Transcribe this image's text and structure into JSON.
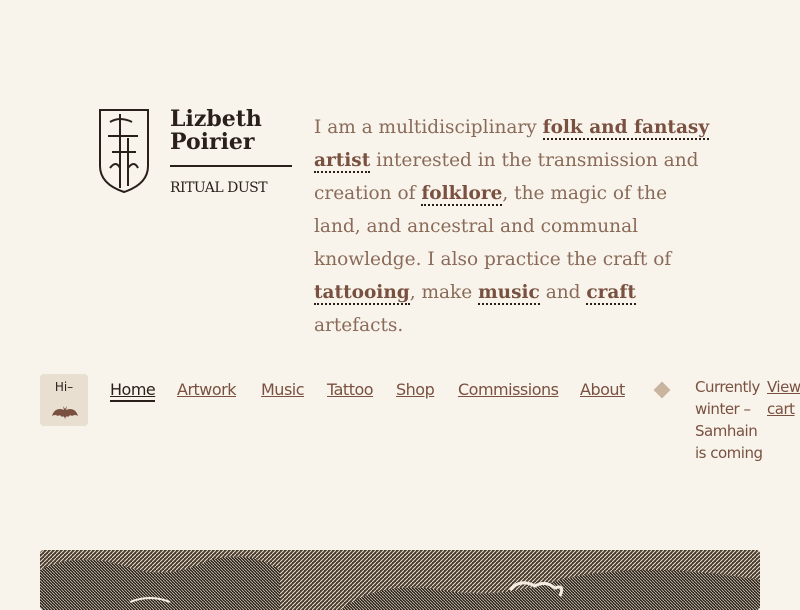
{
  "brand": {
    "name_line1": "Lizbeth",
    "name_line2": "Poirier",
    "tagline": "RITUAL DUST"
  },
  "intro": {
    "p1": "I am a multidisciplinary ",
    "link1": "folk and fantasy artist",
    "p2": " interested in the transmission and creation of ",
    "link2": "folklore",
    "p3": ", the magic of the land, and ancestral and communal knowledge. I also practice the craft of ",
    "link3": "tattooing",
    "p4": ", make ",
    "link4": "music",
    "p5": " and ",
    "link5": "craft",
    "p6": " artefacts."
  },
  "greeting": {
    "label": "Hi–",
    "icon": "bat-icon"
  },
  "nav": {
    "items": [
      {
        "label": "Home",
        "active": true
      },
      {
        "label": "Artwork"
      },
      {
        "label": "Music"
      },
      {
        "label": "Tattoo"
      },
      {
        "label": "Shop"
      },
      {
        "label": "Commissions"
      },
      {
        "label": "About"
      }
    ],
    "separator_icon": "diamond-icon"
  },
  "announcement": "Currently winter – Samhain is coming",
  "cart": "View cart",
  "colors": {
    "background": "#f8f4ec",
    "text": "#8a6a58",
    "accent": "#7a5140",
    "dark": "#2a1f1a",
    "badge": "#e9dfd0"
  }
}
